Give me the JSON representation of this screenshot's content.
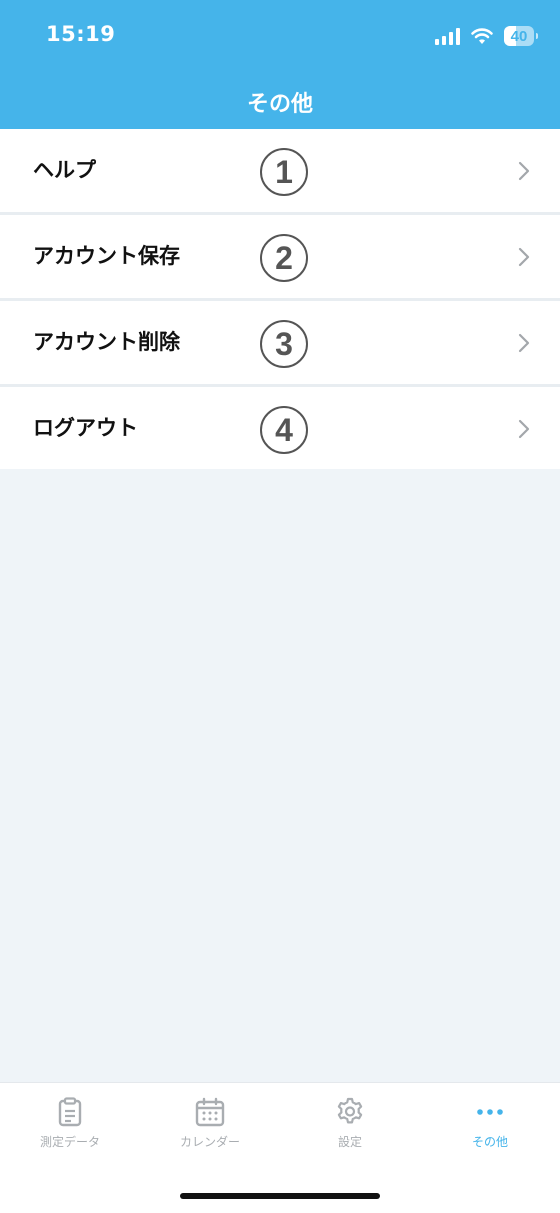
{
  "status_bar": {
    "time": "15:19",
    "battery": "40"
  },
  "header": {
    "title": "その他"
  },
  "menu": {
    "items": [
      {
        "label": "ヘルプ",
        "badge": "1"
      },
      {
        "label": "アカウント保存",
        "badge": "2"
      },
      {
        "label": "アカウント削除",
        "badge": "3"
      },
      {
        "label": "ログアウト",
        "badge": "4"
      }
    ]
  },
  "tabbar": {
    "tabs": [
      {
        "label": "測定データ",
        "icon": "clipboard-icon"
      },
      {
        "label": "カレンダー",
        "icon": "calendar-icon"
      },
      {
        "label": "設定",
        "icon": "gear-icon"
      },
      {
        "label": "その他",
        "icon": "more-icon"
      }
    ],
    "active_color": "#45b4ea",
    "inactive_color": "#a9adb1"
  },
  "colors": {
    "header_bg": "#45b4ea",
    "page_bg": "#eff4f8"
  }
}
